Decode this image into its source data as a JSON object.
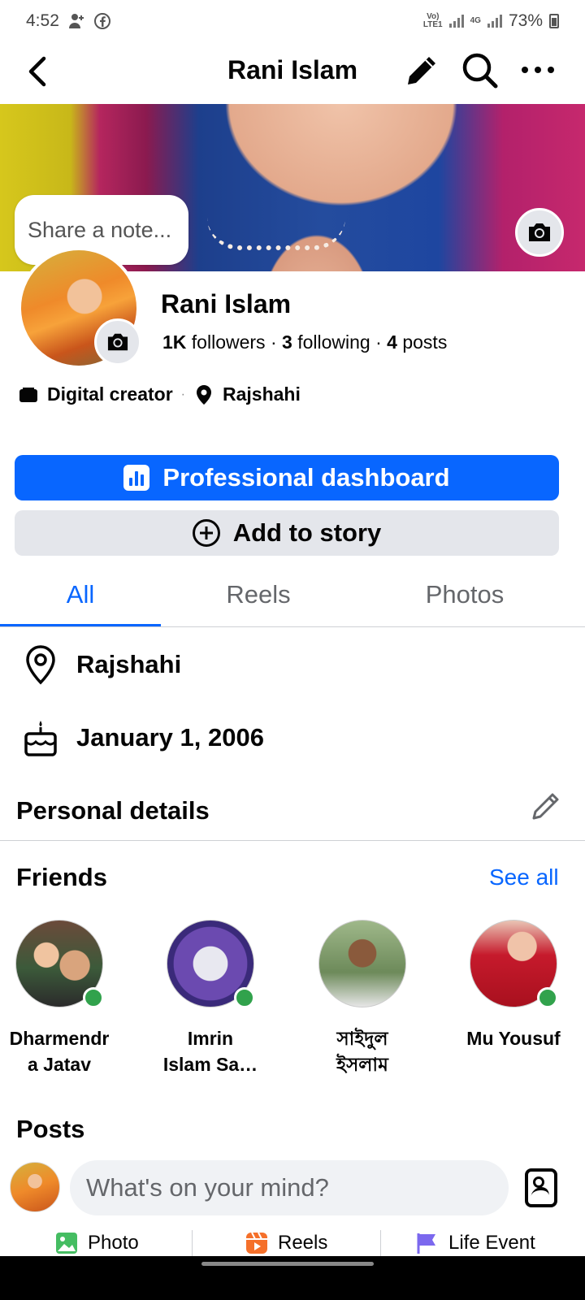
{
  "status_bar": {
    "time": "4:52",
    "network_top": "Vo)",
    "network_bottom": "LTE1",
    "net_type": "4G",
    "battery": "73%"
  },
  "header": {
    "title": "Rani Islam"
  },
  "cover": {
    "note_placeholder": "Share a note..."
  },
  "profile": {
    "name": "Rani Islam",
    "followers_count": "1K",
    "followers_label": "followers",
    "following_count": "3",
    "following_label": "following",
    "posts_count": "4",
    "posts_label": "posts",
    "category": "Digital creator",
    "location": "Rajshahi"
  },
  "actions": {
    "dashboard_label": "Professional dashboard",
    "story_label": "Add to story"
  },
  "tabs": [
    {
      "label": "All",
      "active": true
    },
    {
      "label": "Reels",
      "active": false
    },
    {
      "label": "Photos",
      "active": false
    }
  ],
  "details": {
    "location": "Rajshahi",
    "birthday": "January 1, 2006",
    "personal_details_title": "Personal details"
  },
  "friends": {
    "title": "Friends",
    "see_all": "See all",
    "items": [
      {
        "name": "Dharmendra Jatav",
        "line1": "Dharmendr",
        "line2": "a Jatav",
        "online": true
      },
      {
        "name": "Imrin Islam Sa...",
        "line1": "Imrin",
        "line2": "Islam Sa…",
        "online": true
      },
      {
        "name": "সাইদুল ইসলাম",
        "line1": "সাইদুল",
        "line2": "ইসলাম",
        "online": false
      },
      {
        "name": "Mu Yousuf",
        "line1": "Mu Yousuf",
        "line2": "",
        "online": true
      }
    ]
  },
  "posts": {
    "title": "Posts",
    "composer_placeholder": "What's on your mind?",
    "actions": [
      {
        "label": "Photo",
        "icon": "photo-icon",
        "color": "#45bd62"
      },
      {
        "label": "Reels",
        "icon": "reels-icon",
        "color": "#f5702a"
      },
      {
        "label": "Life Event",
        "icon": "flag-icon",
        "color": "#7b68ee"
      }
    ]
  },
  "colors": {
    "accent": "#0866ff",
    "online": "#31a24c"
  }
}
